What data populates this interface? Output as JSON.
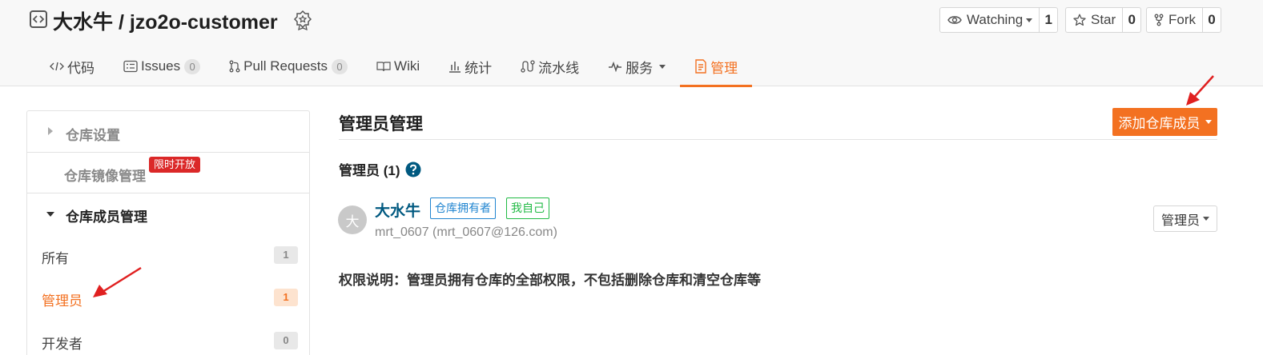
{
  "header": {
    "repo_title": "大水牛 / jzo2o-customer",
    "watch": {
      "label": "Watching",
      "count": "1"
    },
    "star": {
      "label": "Star",
      "count": "0"
    },
    "fork": {
      "label": "Fork",
      "count": "0"
    }
  },
  "tabs": [
    {
      "label": "代码",
      "icon": "code-icon"
    },
    {
      "label": "Issues",
      "icon": "issues-icon",
      "count": "0"
    },
    {
      "label": "Pull Requests",
      "icon": "pull-request-icon",
      "count": "0"
    },
    {
      "label": "Wiki",
      "icon": "wiki-icon"
    },
    {
      "label": "统计",
      "icon": "stats-icon"
    },
    {
      "label": "流水线",
      "icon": "pipeline-icon"
    },
    {
      "label": "服务",
      "icon": "service-icon"
    },
    {
      "label": "管理",
      "icon": "manage-icon",
      "active": true
    }
  ],
  "sidebar": {
    "repo_settings": "仓库设置",
    "mirror_manage": "仓库镜像管理",
    "limit_badge": "限时开放",
    "member_manage": "仓库成员管理",
    "items": [
      {
        "label": "所有",
        "count": "1"
      },
      {
        "label": "管理员",
        "count": "1",
        "active": true
      },
      {
        "label": "开发者",
        "count": "0"
      }
    ]
  },
  "main": {
    "title": "管理员管理",
    "add_button": "添加仓库成员",
    "section_title": "管理员 (1)",
    "member": {
      "avatar_text": "大",
      "name": "大水牛",
      "tag_owner": "仓库拥有者",
      "tag_self": "我自己",
      "email": "mrt_0607 (mrt_0607@126.com)",
      "role": "管理员"
    },
    "permission_note": "权限说明：管理员拥有仓库的全部权限，不包括删除仓库和清空仓库等"
  },
  "colors": {
    "accent": "#f37121",
    "link": "#005980",
    "annotation": "#e02020"
  }
}
